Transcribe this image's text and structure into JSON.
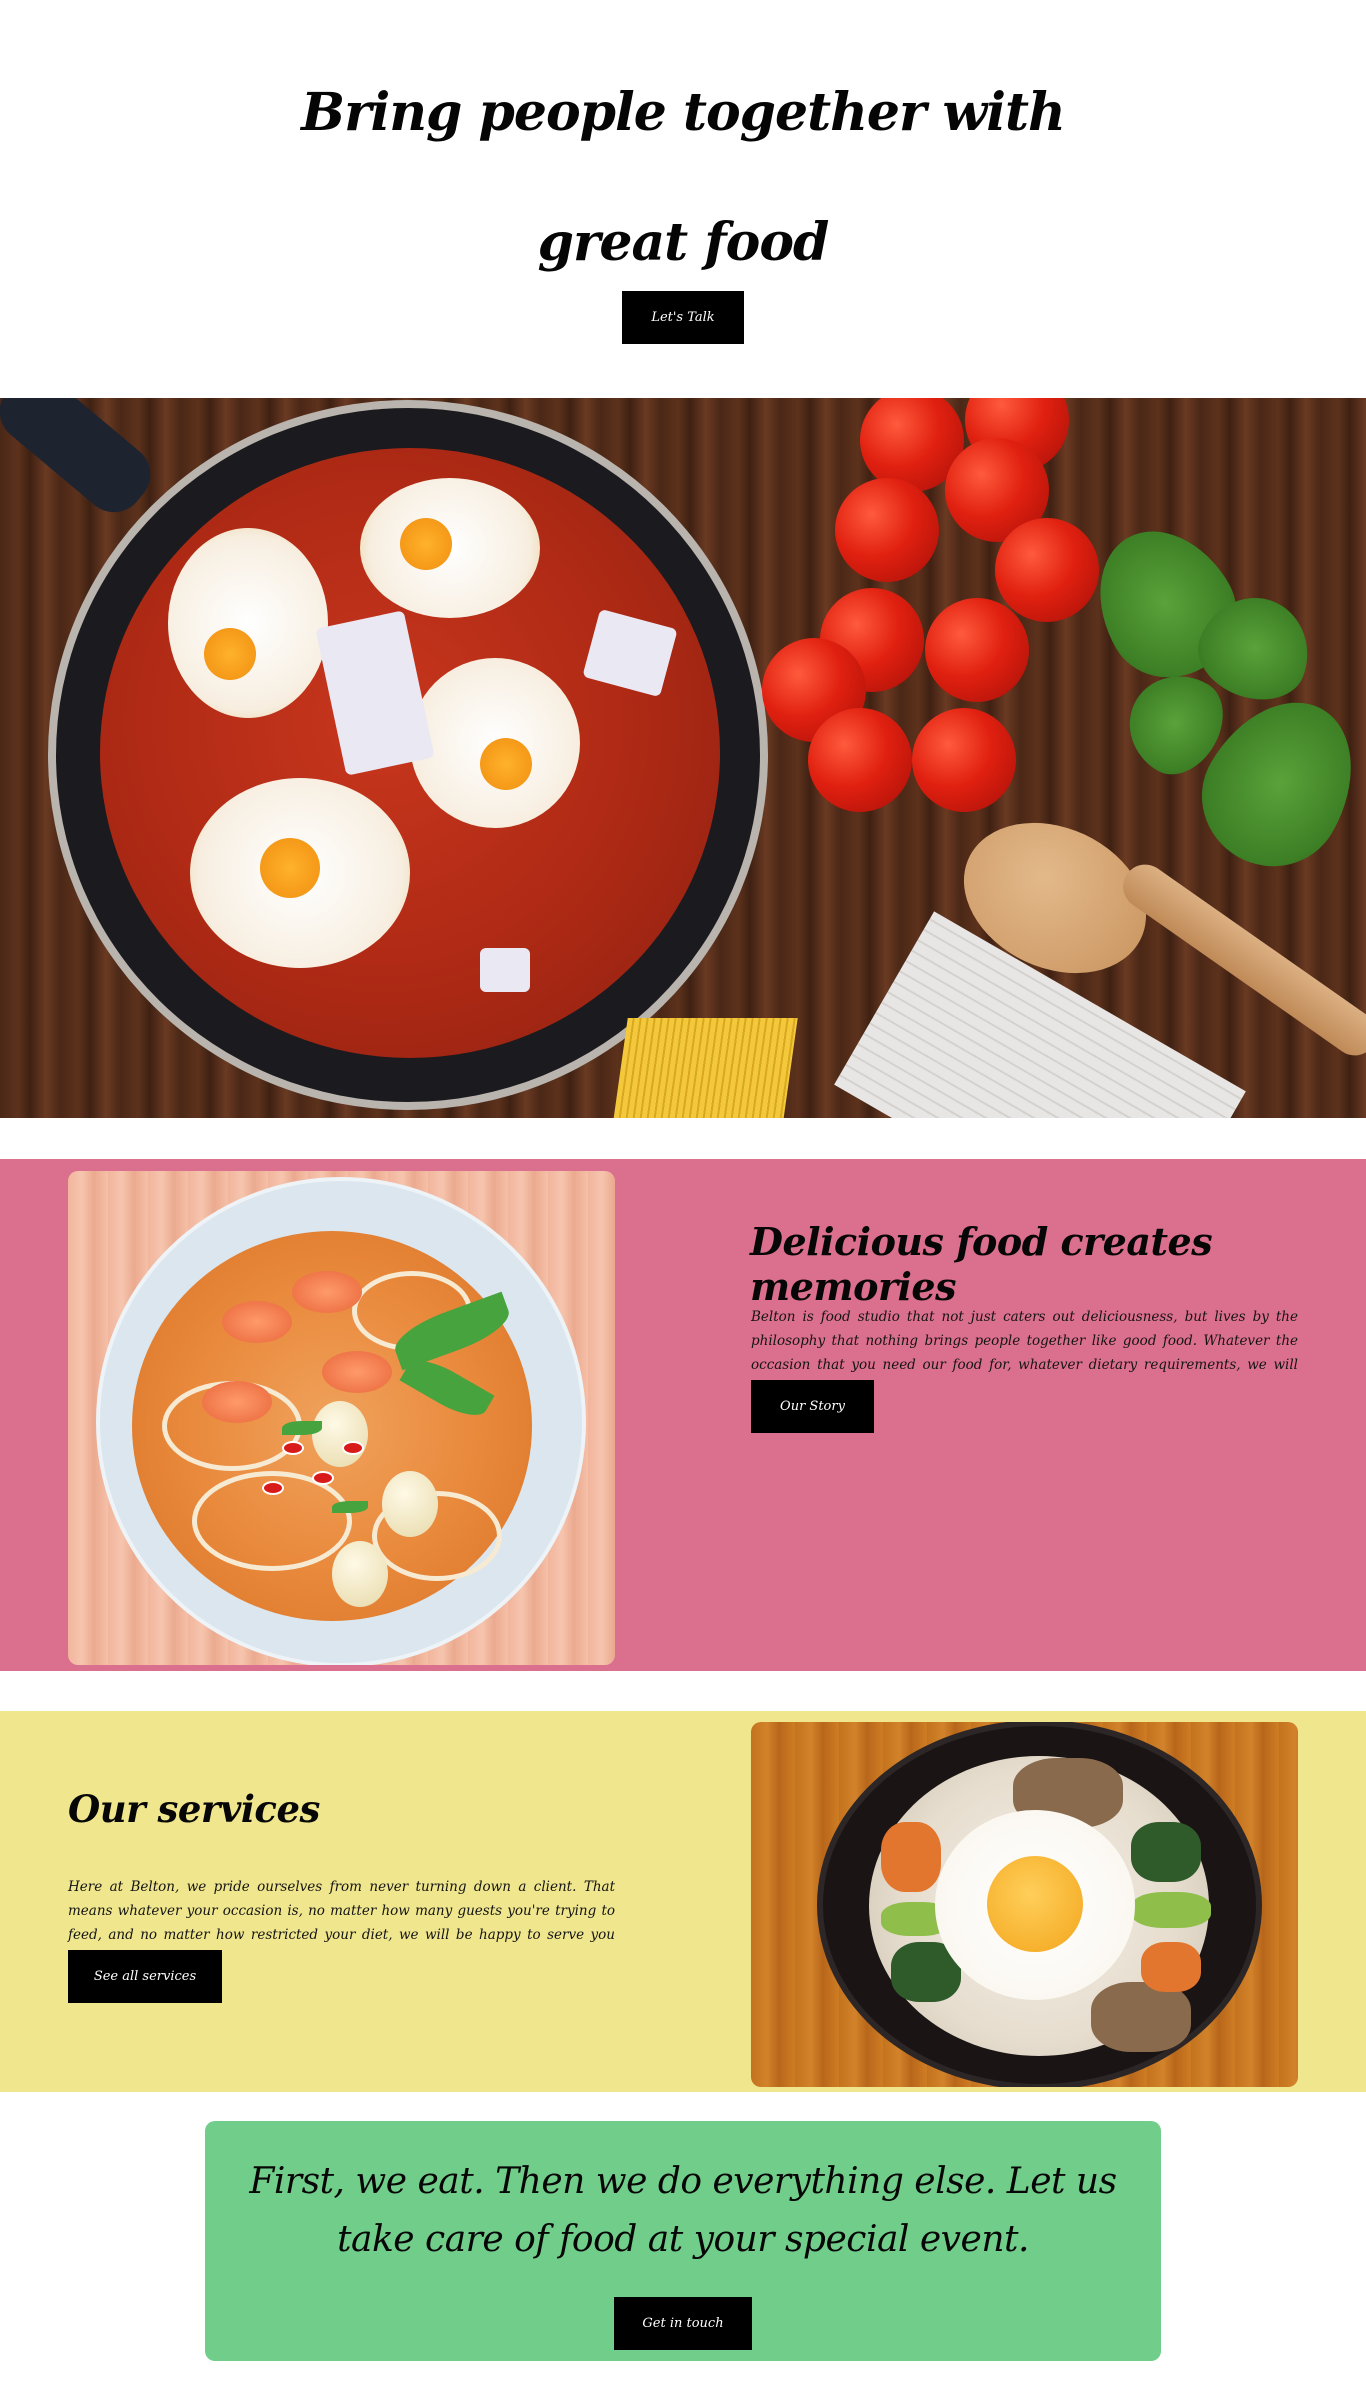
{
  "hero": {
    "title_line1": "Bring people together with",
    "title_line2": "great food",
    "cta_label": "Let's Talk"
  },
  "about": {
    "title": "Delicious food creates memories",
    "text": "Belton is food studio that not just caters out deliciousness, but lives by the philosophy that nothing brings people together like good food. Whatever the occasion that you need our food for, whatever dietary requirements, we will make it happen.",
    "button_label": "Our Story"
  },
  "services": {
    "title": "Our services",
    "text": "Here at Belton, we pride ourselves from never turning down a client. That means whatever your occasion is, no matter how many guests you're trying to feed, and no matter how restricted your diet, we will be happy to serve you delicious food.",
    "button_label": "See all services"
  },
  "cta": {
    "quote": "First, we eat. Then we do everything else. Let us take care of food at your special event.",
    "button_label": "Get in touch"
  },
  "colors": {
    "about_bg": "#db6f8e",
    "services_bg": "#efe68d",
    "cta_bg": "#71cd8a",
    "button_bg": "#000000"
  }
}
